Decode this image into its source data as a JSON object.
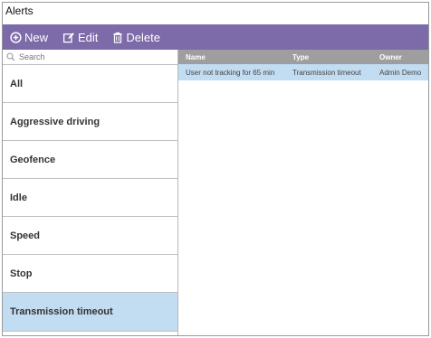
{
  "window": {
    "title": "Alerts"
  },
  "toolbar": {
    "new_label": "New",
    "edit_label": "Edit",
    "delete_label": "Delete"
  },
  "search": {
    "placeholder": "Search"
  },
  "categories": [
    {
      "label": "All"
    },
    {
      "label": "Aggressive driving"
    },
    {
      "label": "Geofence"
    },
    {
      "label": "Idle"
    },
    {
      "label": "Speed"
    },
    {
      "label": "Stop"
    },
    {
      "label": "Transmission timeout",
      "selected": true
    }
  ],
  "table": {
    "columns": [
      "Name",
      "Type",
      "Owner"
    ],
    "rows": [
      [
        "User not tracking for 65 min",
        "Transmission timeout",
        "Admin Demo"
      ]
    ]
  },
  "colors": {
    "toolbar": "#7d6aa9",
    "selection": "#c2dcf1",
    "header": "#9e9e9e"
  }
}
